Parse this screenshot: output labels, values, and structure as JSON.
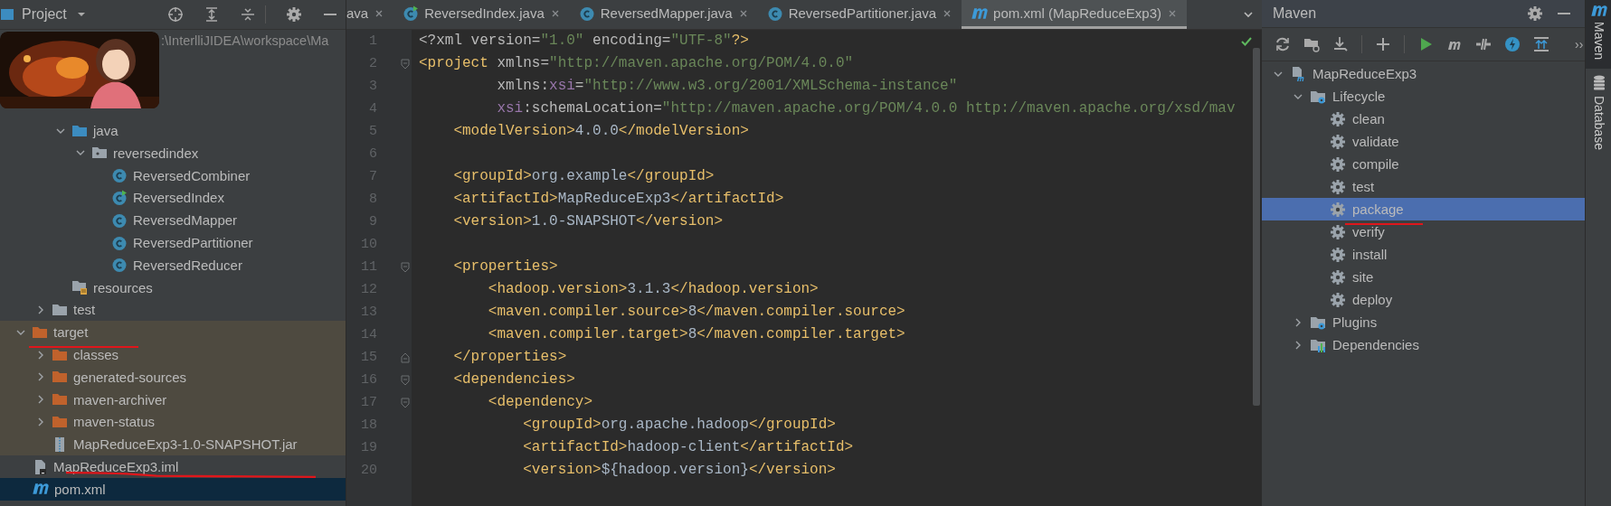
{
  "project_panel": {
    "title": "Project",
    "tree": [
      {
        "path": ":\\InterlliJIDEA\\workspace\\Ma",
        "children": [
          {
            "children": [
              {
                "children": [
                  {
                    "label": "java",
                    "kind": "sourcefolder",
                    "expanded": true,
                    "selected": false,
                    "children": [
                      {
                        "label": "reversedindex",
                        "kind": "package",
                        "expanded": true,
                        "selected": false,
                        "children": [
                          {
                            "label": "ReversedCombiner",
                            "kind": "class",
                            "selected": false
                          },
                          {
                            "label": "ReversedIndex",
                            "kind": "runclass",
                            "selected": false
                          },
                          {
                            "label": "ReversedMapper",
                            "kind": "class",
                            "selected": false
                          },
                          {
                            "label": "ReversedPartitioner",
                            "kind": "class",
                            "selected": false
                          },
                          {
                            "label": "ReversedReducer",
                            "kind": "class",
                            "selected": false
                          }
                        ]
                      }
                    ]
                  },
                  {
                    "label": "resources",
                    "kind": "resources",
                    "selected": false
                  }
                ]
              },
              {
                "label": "test",
                "kind": "folder",
                "expanded": false,
                "selected": false
              }
            ]
          },
          {
            "label": "target",
            "kind": "excluded",
            "expanded": true,
            "highlighted": true,
            "selected": false,
            "children": [
              {
                "label": "classes",
                "kind": "excluded",
                "expanded": false,
                "selected": false
              },
              {
                "label": "generated-sources",
                "kind": "excluded",
                "expanded": false,
                "selected": false
              },
              {
                "label": "maven-archiver",
                "kind": "excluded",
                "expanded": false,
                "selected": false
              },
              {
                "label": "maven-status",
                "kind": "excluded",
                "expanded": false,
                "selected": false
              },
              {
                "label": "MapReduceExp3-1.0-SNAPSHOT.jar",
                "kind": "jar",
                "selected": false
              }
            ]
          },
          {
            "label": "MapReduceExp3.iml",
            "kind": "module",
            "selected": false
          },
          {
            "label": "pom.xml",
            "kind": "maven",
            "selected": true
          }
        ]
      }
    ]
  },
  "editor": {
    "tabs": [
      {
        "label": "ava",
        "selected": false
      },
      {
        "label": "ReversedIndex.java",
        "kind": "runclass",
        "selected": false
      },
      {
        "label": "ReversedMapper.java",
        "kind": "class",
        "selected": false
      },
      {
        "label": "ReversedPartitioner.java",
        "kind": "class",
        "selected": false
      },
      {
        "label": "pom.xml (MapReduceExp3)",
        "kind": "maven",
        "selected": true
      }
    ],
    "lines": [
      {
        "n": "1",
        "kind": "plain",
        "code": [
          {
            "kind": "attr",
            "text": "<?xml version="
          },
          {
            "kind": "str",
            "text": "\"1.0\""
          },
          {
            "kind": "attr",
            "text": " encoding="
          },
          {
            "kind": "str",
            "text": "\"UTF-8\""
          },
          {
            "kind": "tag",
            "text": "?>"
          }
        ]
      },
      {
        "n": "2",
        "kind": "opener",
        "code": [
          {
            "kind": "tag",
            "text": "<project"
          },
          {
            "kind": "attr",
            "text": " xmlns="
          },
          {
            "kind": "str",
            "text": "\"http://maven.apache.org/POM/4.0.0\""
          }
        ]
      },
      {
        "n": "3",
        "kind": "plain",
        "code": [
          {
            "kind": "attr",
            "text": "         xmlns:"
          },
          {
            "kind": "ns",
            "text": "xsi"
          },
          {
            "kind": "attr",
            "text": "="
          },
          {
            "kind": "str",
            "text": "\"http://www.w3.org/2001/XMLSchema-instance\""
          }
        ]
      },
      {
        "n": "4",
        "kind": "plain",
        "code": [
          {
            "kind": "ns",
            "text": "         xsi"
          },
          {
            "kind": "attr",
            "text": ":schemaLocation="
          },
          {
            "kind": "str",
            "text": "\"http://maven.apache.org/POM/4.0.0 http://maven.apache.org/xsd/mav"
          }
        ]
      },
      {
        "n": "5",
        "kind": "plain",
        "code": [
          {
            "kind": "tag",
            "text": "    <modelVersion>"
          },
          {
            "kind": "text",
            "text": "4.0.0"
          },
          {
            "kind": "tag",
            "text": "</modelVersion>"
          }
        ]
      },
      {
        "n": "6",
        "kind": "plain"
      },
      {
        "n": "7",
        "kind": "plain",
        "code": [
          {
            "kind": "tag",
            "text": "    <groupId>"
          },
          {
            "kind": "text",
            "text": "org.example"
          },
          {
            "kind": "tag",
            "text": "</groupId>"
          }
        ]
      },
      {
        "n": "8",
        "kind": "plain",
        "code": [
          {
            "kind": "tag",
            "text": "    <artifactId>"
          },
          {
            "kind": "text",
            "text": "MapReduceExp3"
          },
          {
            "kind": "tag",
            "text": "</artifactId>"
          }
        ]
      },
      {
        "n": "9",
        "kind": "plain",
        "code": [
          {
            "kind": "tag",
            "text": "    <version>"
          },
          {
            "kind": "text",
            "text": "1.0-SNAPSHOT"
          },
          {
            "kind": "tag",
            "text": "</version>"
          }
        ]
      },
      {
        "n": "10",
        "kind": "plain"
      },
      {
        "n": "11",
        "kind": "opener",
        "code": [
          {
            "kind": "tag",
            "text": "    <properties>"
          }
        ]
      },
      {
        "n": "12",
        "kind": "plain",
        "code": [
          {
            "kind": "tag",
            "text": "        <hadoop.version>"
          },
          {
            "kind": "text",
            "text": "3.1.3"
          },
          {
            "kind": "tag",
            "text": "</hadoop.version>"
          }
        ]
      },
      {
        "n": "13",
        "kind": "plain",
        "code": [
          {
            "kind": "tag",
            "text": "        <maven.compiler.source>"
          },
          {
            "kind": "text",
            "text": "8"
          },
          {
            "kind": "tag",
            "text": "</maven.compiler.source>"
          }
        ]
      },
      {
        "n": "14",
        "kind": "plain",
        "code": [
          {
            "kind": "tag",
            "text": "        <maven.compiler.target>"
          },
          {
            "kind": "text",
            "text": "8"
          },
          {
            "kind": "tag",
            "text": "</maven.compiler.target>"
          }
        ]
      },
      {
        "n": "15",
        "kind": "closer",
        "code": [
          {
            "kind": "tag",
            "text": "    </properties>"
          }
        ]
      },
      {
        "n": "16",
        "kind": "opener",
        "code": [
          {
            "kind": "tag",
            "text": "    <dependencies>"
          }
        ]
      },
      {
        "n": "17",
        "kind": "opener",
        "code": [
          {
            "kind": "tag",
            "text": "        <dependency>"
          }
        ]
      },
      {
        "n": "18",
        "kind": "plain",
        "code": [
          {
            "kind": "tag",
            "text": "            <groupId>"
          },
          {
            "kind": "text",
            "text": "org.apache.hadoop"
          },
          {
            "kind": "tag",
            "text": "</groupId>"
          }
        ]
      },
      {
        "n": "19",
        "kind": "plain",
        "code": [
          {
            "kind": "tag",
            "text": "            <artifactId>"
          },
          {
            "kind": "text",
            "text": "hadoop-client"
          },
          {
            "kind": "tag",
            "text": "</artifactId>"
          }
        ]
      },
      {
        "n": "20",
        "kind": "plain",
        "code": [
          {
            "kind": "tag",
            "text": "            <version>"
          },
          {
            "kind": "text",
            "text": "${hadoop.version}"
          },
          {
            "kind": "tag",
            "text": "</version>"
          }
        ]
      }
    ]
  },
  "maven_panel": {
    "title": "Maven",
    "more": "››",
    "tree": [
      {
        "label": "MapReduceExp3",
        "kind": "mavenproject",
        "expanded": true,
        "selected": false,
        "children": [
          {
            "label": "Lifecycle",
            "kind": "lifecycle",
            "expanded": true,
            "selected": false,
            "children": [
              {
                "label": "clean",
                "kind": "goal",
                "selected": false
              },
              {
                "label": "validate",
                "kind": "goal",
                "selected": false
              },
              {
                "label": "compile",
                "kind": "goal",
                "selected": false
              },
              {
                "label": "test",
                "kind": "goal",
                "selected": false
              },
              {
                "label": "package",
                "kind": "goal",
                "selected": true
              },
              {
                "label": "verify",
                "kind": "goal",
                "selected": false
              },
              {
                "label": "install",
                "kind": "goal",
                "selected": false
              },
              {
                "label": "site",
                "kind": "goal",
                "selected": false
              },
              {
                "label": "deploy",
                "kind": "goal",
                "selected": false
              }
            ]
          },
          {
            "label": "Plugins",
            "kind": "lifecycle",
            "expanded": false,
            "selected": false
          },
          {
            "label": "Dependencies",
            "kind": "dependencies",
            "expanded": false,
            "selected": false
          }
        ]
      }
    ]
  },
  "side_strip": [
    {
      "label": "Maven",
      "kind": "maven",
      "selected": true
    },
    {
      "label": "Database",
      "kind": "database",
      "selected": false
    }
  ]
}
